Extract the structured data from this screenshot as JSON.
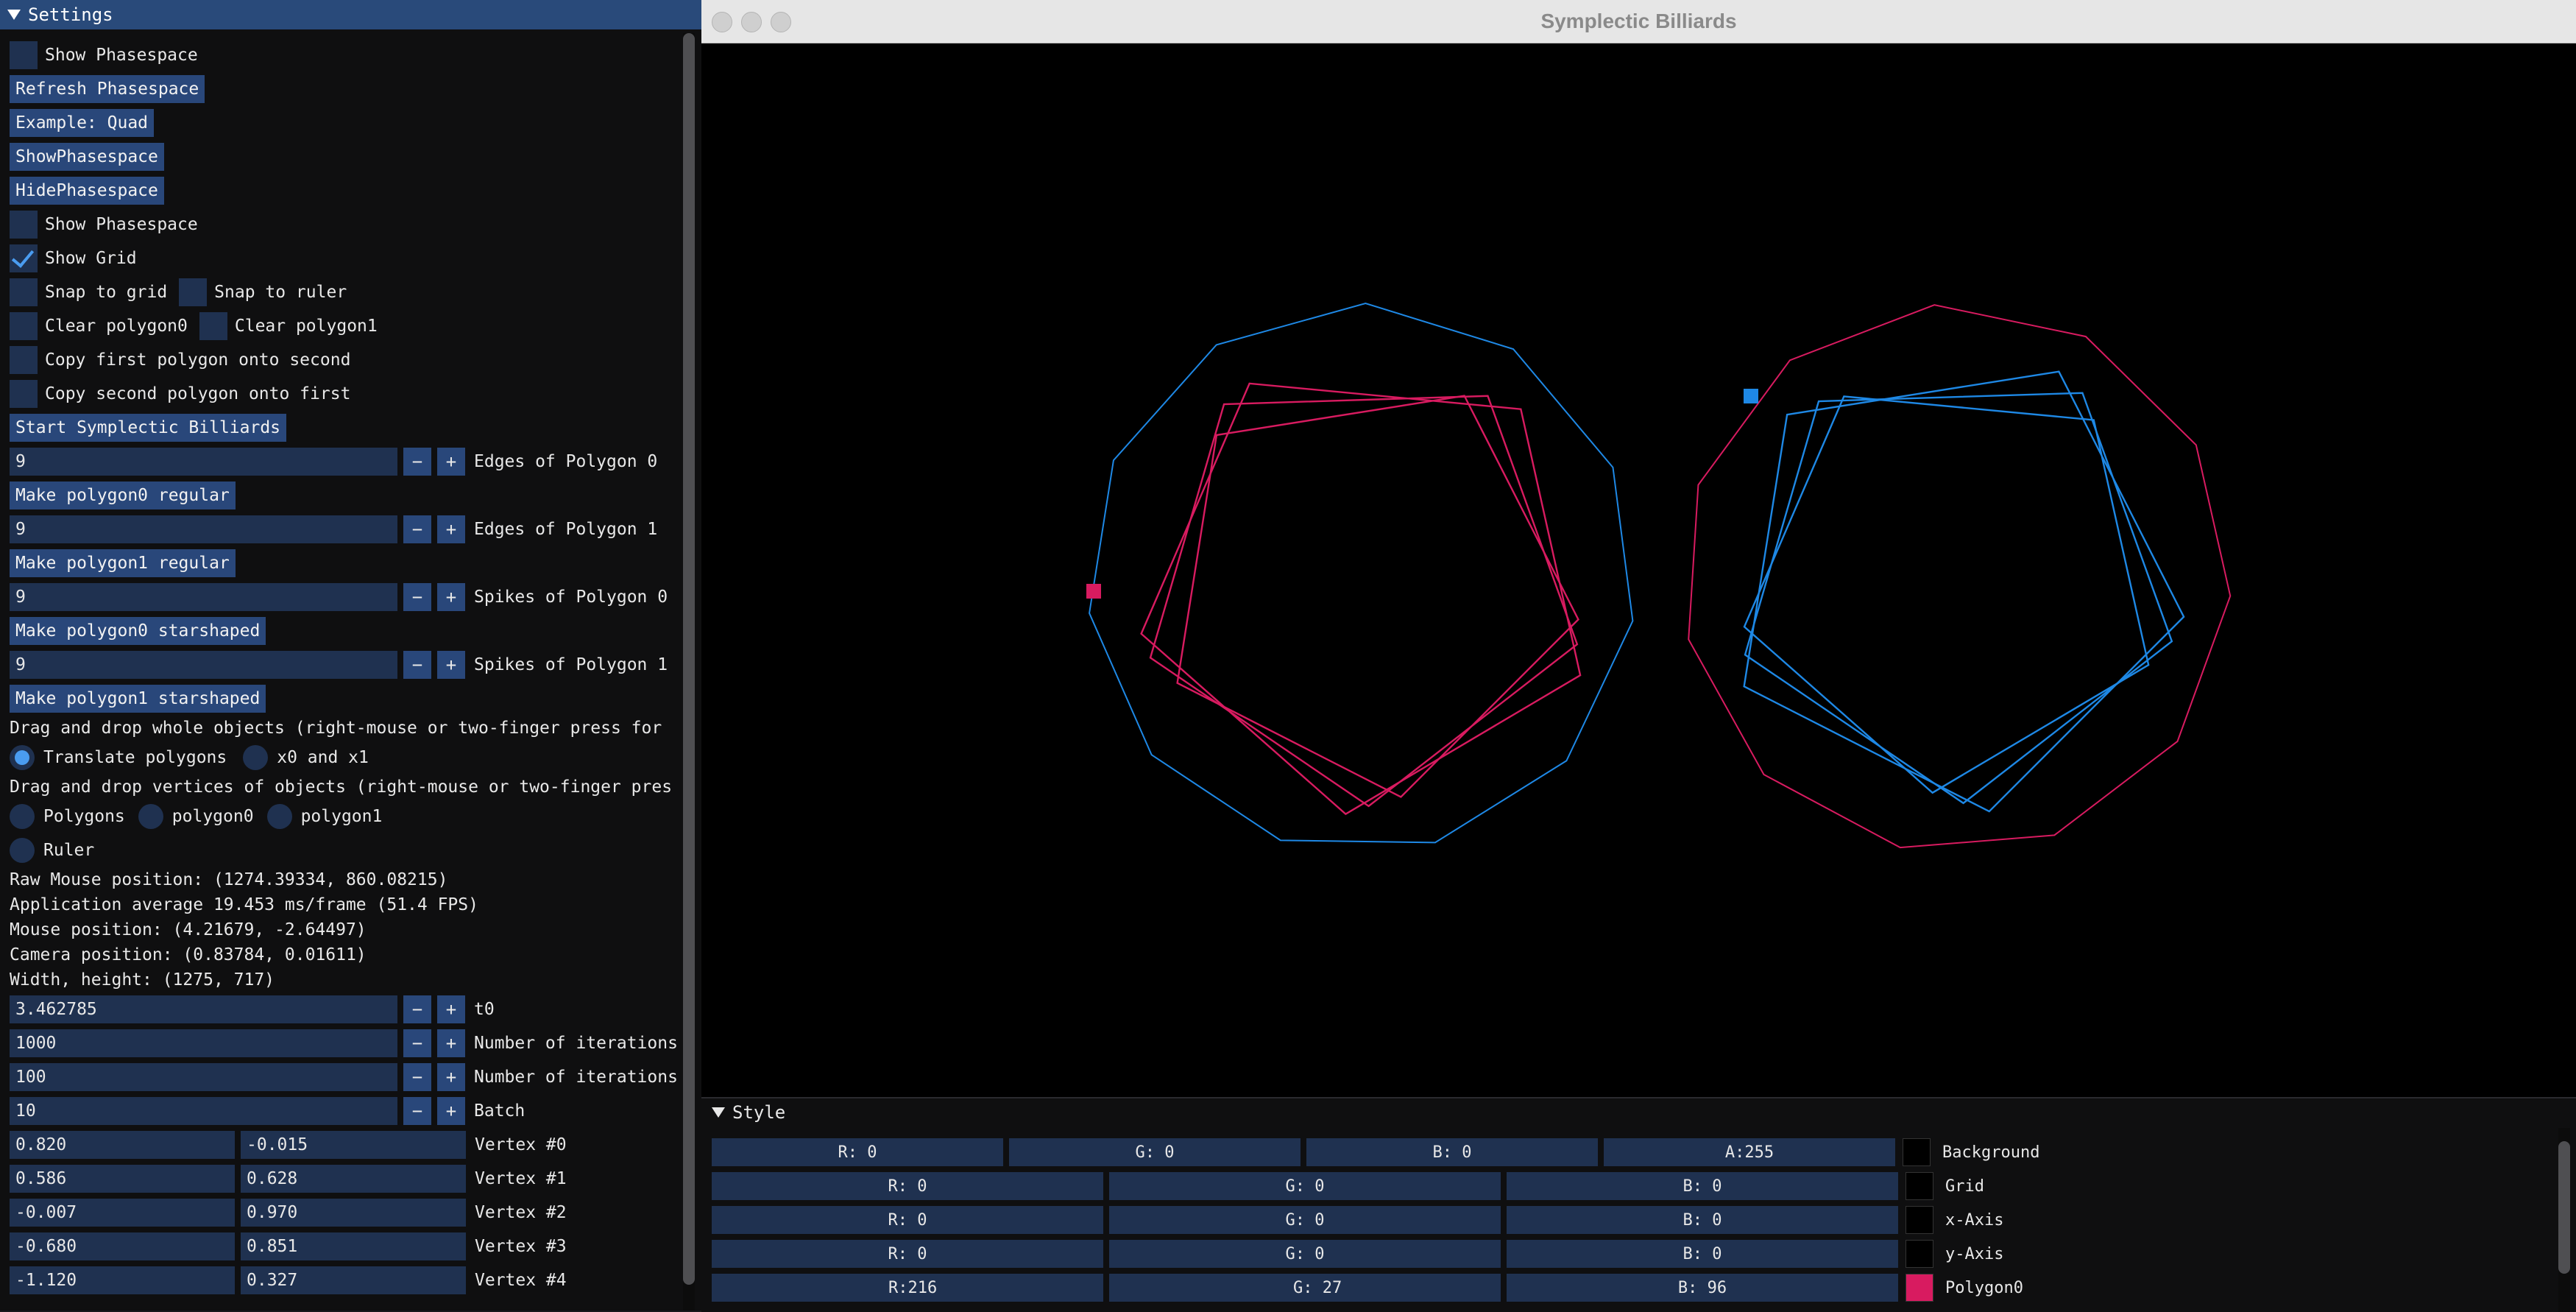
{
  "settings": {
    "title": "Settings",
    "show_phasespace": "Show Phasespace",
    "refresh_phasespace": "Refresh Phasespace",
    "example_quad": "Example: Quad",
    "show_phasespace_btn": "ShowPhasespace",
    "hide_phasespace_btn": "HidePhasespace",
    "show_phasespace2": "Show Phasespace",
    "show_grid": "Show Grid",
    "snap_grid": "Snap to grid",
    "snap_ruler": "Snap to ruler",
    "clear_poly0": "Clear polygon0",
    "clear_poly1": "Clear polygon1",
    "copy_first": "Copy first polygon onto second",
    "copy_second": "Copy second polygon onto first",
    "start_billiards": "Start Symplectic Billiards",
    "edges0": {
      "value": "9",
      "label": "Edges of Polygon 0"
    },
    "make_reg0": "Make polygon0 regular",
    "edges1": {
      "value": "9",
      "label": "Edges of Polygon 1"
    },
    "make_reg1": "Make polygon1 regular",
    "spikes0": {
      "value": "9",
      "label": "Spikes of Polygon 0"
    },
    "make_star0": "Make polygon0 starshaped",
    "spikes1": {
      "value": "9",
      "label": "Spikes of Polygon 1"
    },
    "make_star1": "Make polygon1 starshaped",
    "drag_whole": "Drag and drop whole objects (right-mouse or  two-finger press for",
    "translate_polygons": "Translate polygons",
    "x0_x1": "x0 and x1",
    "drag_vertices": "Drag and drop vertices of objects (right-mouse or two-finger pres",
    "polygons": "Polygons",
    "polygon0": "polygon0",
    "polygon1": "polygon1",
    "ruler": "Ruler",
    "raw_mouse": "Raw Mouse position: (1274.39334, 860.08215)",
    "app_avg": "Application average 19.453 ms/frame (51.4 FPS)",
    "mouse_pos": "Mouse position: (4.21679, -2.64497)",
    "camera_pos": "Camera position: (0.83784, 0.01611)",
    "width_height": "Width, height: (1275, 717)",
    "t0": {
      "value": "3.462785",
      "label": "t0"
    },
    "iter1": {
      "value": "1000",
      "label": "Number of iterations"
    },
    "iter2": {
      "value": "100",
      "label": "Number of iterations"
    },
    "batch": {
      "value": "10",
      "label": "Batch"
    },
    "minus": "−",
    "plus": "+",
    "vertices": [
      {
        "x": "0.820",
        "y": "-0.015",
        "label": "Vertex #0"
      },
      {
        "x": "0.586",
        "y": "0.628",
        "label": "Vertex #1"
      },
      {
        "x": "-0.007",
        "y": "0.970",
        "label": "Vertex #2"
      },
      {
        "x": "-0.680",
        "y": "0.851",
        "label": "Vertex #3"
      },
      {
        "x": "-1.120",
        "y": "0.327",
        "label": "Vertex #4"
      }
    ]
  },
  "window": {
    "title": "Symplectic Billiards"
  },
  "style": {
    "title": "Style",
    "rows": [
      {
        "cells": [
          "R:  0",
          "G:  0",
          "B:  0",
          "A:255"
        ],
        "label": "Background",
        "color": "#000000"
      },
      {
        "cells": [
          "R:  0",
          "G:  0",
          "B:  0"
        ],
        "label": "Grid",
        "color": "#000000"
      },
      {
        "cells": [
          "R:  0",
          "G:  0",
          "B:  0"
        ],
        "label": "x-Axis",
        "color": "#000000"
      },
      {
        "cells": [
          "R:  0",
          "G:  0",
          "B:  0"
        ],
        "label": "y-Axis",
        "color": "#000000"
      },
      {
        "cells": [
          "R:216",
          "G: 27",
          "B: 96"
        ],
        "label": "Polygon0",
        "color": "#d81b60"
      }
    ]
  },
  "colors": {
    "polygon0": "#d81b60",
    "polygon1": "#1e88e5"
  }
}
